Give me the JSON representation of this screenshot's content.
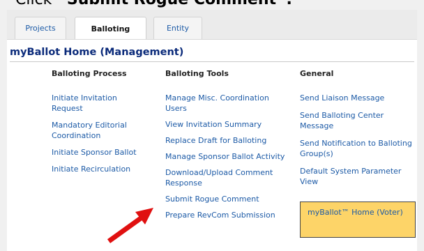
{
  "caption": {
    "prefix": "Click ",
    "bold_text": "“Submit Rogue Comment”."
  },
  "tabs": [
    {
      "label": "Projects"
    },
    {
      "label": "Balloting"
    },
    {
      "label": "Entity"
    }
  ],
  "panel": {
    "title": "myBallot Home (Management)"
  },
  "columns": [
    {
      "heading": "Balloting Process",
      "links": [
        "Initiate Invitation Request",
        "Mandatory Editorial Coordination",
        "Initiate Sponsor Ballot",
        "Initiate Recirculation"
      ]
    },
    {
      "heading": "Balloting Tools",
      "links": [
        "Manage Misc. Coordination Users",
        "View Invitation Summary",
        "Replace Draft for Balloting",
        "Manage Sponsor Ballot Activity",
        "Download/Upload Comment Response",
        "Submit Rogue Comment",
        "Prepare RevCom Submission"
      ]
    },
    {
      "heading": "General",
      "links": [
        "Send Liaison Message",
        "Send Balloting Center Message",
        "Send Notification to Balloting Group(s)",
        "Default System Parameter View"
      ]
    }
  ],
  "voter_box": {
    "label": "myBallot™ Home (Voter)"
  },
  "colors": {
    "link": "#1c5aa6",
    "title": "#0a2a7a",
    "voter_box_bg": "#fdd468",
    "arrow": "#e01010"
  }
}
